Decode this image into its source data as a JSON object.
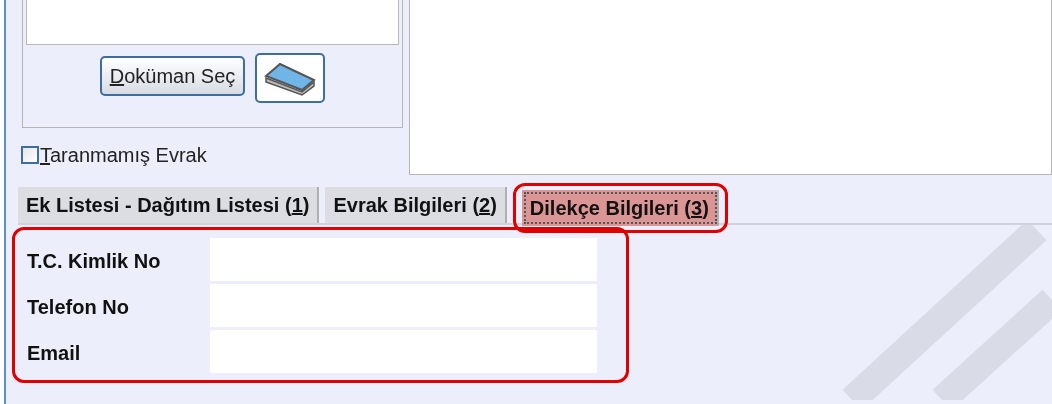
{
  "document_panel": {
    "select_button": {
      "mnemonic": "D",
      "rest": "oküman Seç"
    }
  },
  "unscanned_checkbox": {
    "mnemonic": "T",
    "rest": "aranmamış Evrak",
    "checked": false
  },
  "tabs": [
    {
      "label": "Ek Listesi - Dağıtım Listesi (",
      "mnemonic": "1",
      "close": ")",
      "selected": false,
      "highlighted": false
    },
    {
      "label": "Evrak Bilgileri (",
      "mnemonic": "2",
      "close": ")",
      "selected": false,
      "highlighted": false
    },
    {
      "label": "Dilekçe Bilgileri (",
      "mnemonic": "3",
      "close": ")",
      "selected": true,
      "highlighted": true
    }
  ],
  "form": {
    "highlighted": true,
    "fields": [
      {
        "label": "T.C. Kimlik No"
      },
      {
        "label": "Telefon No"
      },
      {
        "label": "Email"
      }
    ]
  }
}
